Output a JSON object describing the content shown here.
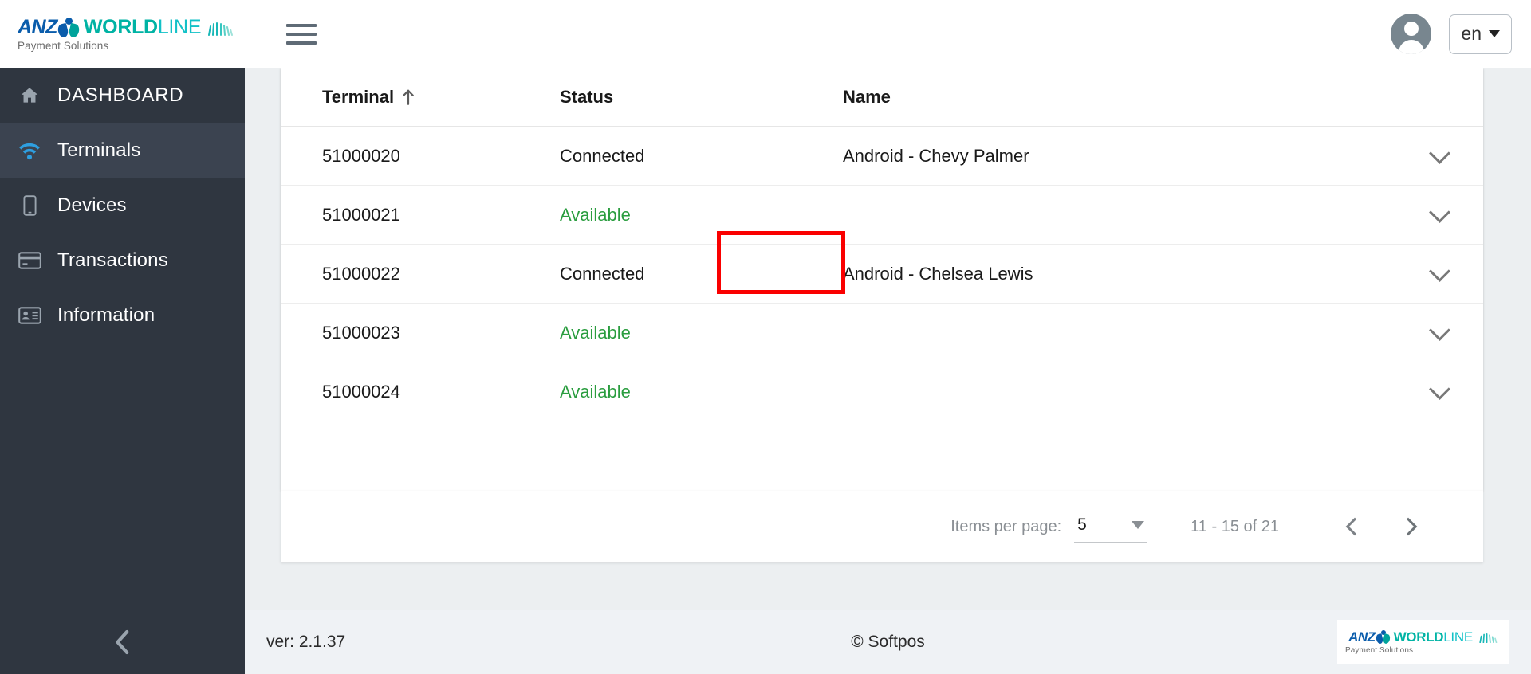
{
  "brand": {
    "anz": "ANZ",
    "world": "WORLD",
    "line": "LINE",
    "tagline": "Payment Solutions"
  },
  "topbar": {
    "menu_icon": "hamburger-icon",
    "avatar_icon": "user-avatar-icon",
    "language": "en"
  },
  "sidebar": {
    "items": [
      {
        "label": "DASHBOARD",
        "icon": "home-icon",
        "active": false
      },
      {
        "label": "Terminals",
        "icon": "wifi-icon",
        "active": true
      },
      {
        "label": "Devices",
        "icon": "mobile-icon",
        "active": false
      },
      {
        "label": "Transactions",
        "icon": "credit-card-icon",
        "active": false
      },
      {
        "label": "Information",
        "icon": "id-card-icon",
        "active": false
      }
    ],
    "collapse_icon": "chevron-left-icon"
  },
  "table": {
    "columns": [
      {
        "label": "Terminal",
        "sort": "ascending",
        "sort_icon": "arrow-up-icon"
      },
      {
        "label": "Status"
      },
      {
        "label": "Name"
      }
    ],
    "rows": [
      {
        "terminal": "51000020",
        "status": "Connected",
        "status_state": "connected",
        "name": "Android - Chevy Palmer",
        "expand_icon": "chevron-down-icon"
      },
      {
        "terminal": "51000021",
        "status": "Available",
        "status_state": "available",
        "name": "",
        "expand_icon": "chevron-down-icon"
      },
      {
        "terminal": "51000022",
        "status": "Connected",
        "status_state": "connected",
        "name": "Android - Chelsea Lewis",
        "expand_icon": "chevron-down-icon"
      },
      {
        "terminal": "51000023",
        "status": "Available",
        "status_state": "available",
        "name": "",
        "expand_icon": "chevron-down-icon"
      },
      {
        "terminal": "51000024",
        "status": "Available",
        "status_state": "available",
        "name": "",
        "expand_icon": "chevron-down-icon"
      }
    ]
  },
  "paginator": {
    "items_per_page_label": "Items per page:",
    "items_per_page_value": "5",
    "range_label": "11 - 15 of 21",
    "prev_icon": "chevron-left-icon",
    "next_icon": "chevron-right-icon",
    "dropdown_icon": "triangle-down-icon"
  },
  "footer": {
    "version": "ver: 2.1.37",
    "copyright": "© Softpos"
  },
  "colors": {
    "accent_blue": "#2e9fe0",
    "brand_blue": "#0a5cab",
    "brand_teal": "#00b3a4",
    "status_available": "#2a9d3f",
    "highlight_red": "#fa0000",
    "sidebar_bg": "#2f3640"
  }
}
